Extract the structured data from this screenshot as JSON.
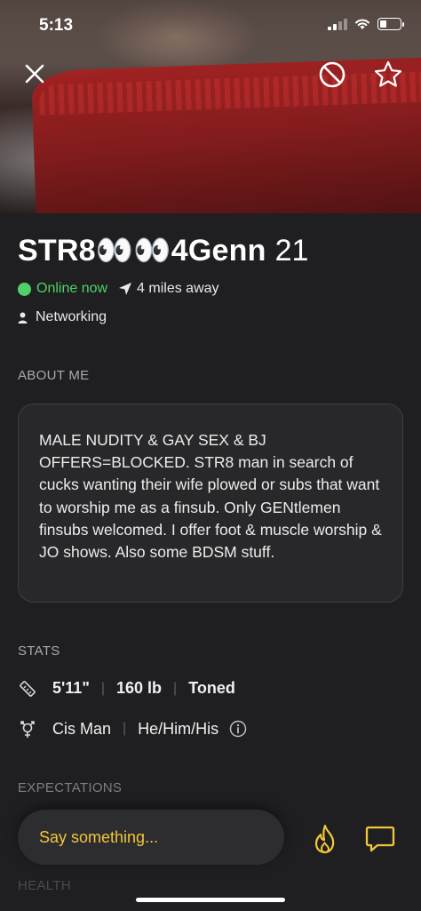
{
  "status_bar": {
    "time": "5:13"
  },
  "profile": {
    "name": "STR8👀👀4Genn",
    "age": "21",
    "online_status": "Online now",
    "distance": "4 miles away",
    "looking_for": "Networking"
  },
  "about": {
    "heading": "ABOUT ME",
    "text": "MALE NUDITY & GAY SEX & BJ OFFERS=BLOCKED. STR8 man in search of cucks wanting their wife plowed or subs that want to worship me as a finsub. Only GENtlemen finsubs welcomed. I offer foot & muscle worship & JO shows. Also some BDSM stuff."
  },
  "stats": {
    "heading": "STATS",
    "height": "5'11\"",
    "weight": "160 lb",
    "body_type": "Toned",
    "gender": "Cis Man",
    "pronouns": "He/Him/His"
  },
  "expectations": {
    "heading": "EXPECTATIONS"
  },
  "health": {
    "heading": "HEALTH"
  },
  "composer": {
    "placeholder": "Say something..."
  },
  "colors": {
    "accent": "#f3c637",
    "online": "#4fd16a",
    "background": "#1f1f21"
  },
  "icons": [
    "close-icon",
    "block-icon",
    "star-icon",
    "location-arrow-icon",
    "person-icon",
    "ruler-icon",
    "gender-icon",
    "info-icon",
    "flame-icon",
    "chat-icon"
  ]
}
